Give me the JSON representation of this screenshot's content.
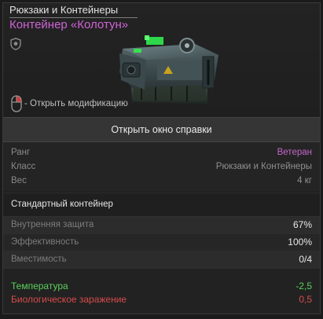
{
  "header": {
    "category": "Рюкзаки и Контейнеры",
    "item_name": "Контейнер «Колотун»",
    "hint_text": "- Открыть модификацию"
  },
  "help_button": "Открыть окно справки",
  "stats": [
    {
      "label": "Ранг",
      "value": "Ветеран"
    },
    {
      "label": "Класс",
      "value": "Рюкзаки и Контейнеры"
    },
    {
      "label": "Вес",
      "value": "4 кг"
    }
  ],
  "description": "Стандартный контейнер",
  "attributes": [
    {
      "label": "Внутренняя защита",
      "value": "67%"
    },
    {
      "label": "Эффективность",
      "value": "100%"
    },
    {
      "label": "Вместимость",
      "value": "0/4"
    }
  ],
  "effects": [
    {
      "label": "Температура",
      "value": "-2,5"
    },
    {
      "label": "Биологическое заражение",
      "value": "0,5"
    }
  ],
  "colors": {
    "rank": "#c766cc",
    "item_name": "#cf63d6",
    "positive": "#5bd05b",
    "negative": "#d84b4b"
  },
  "icons": {
    "shield": "shield-icon",
    "mouse": "mouse-icon"
  }
}
